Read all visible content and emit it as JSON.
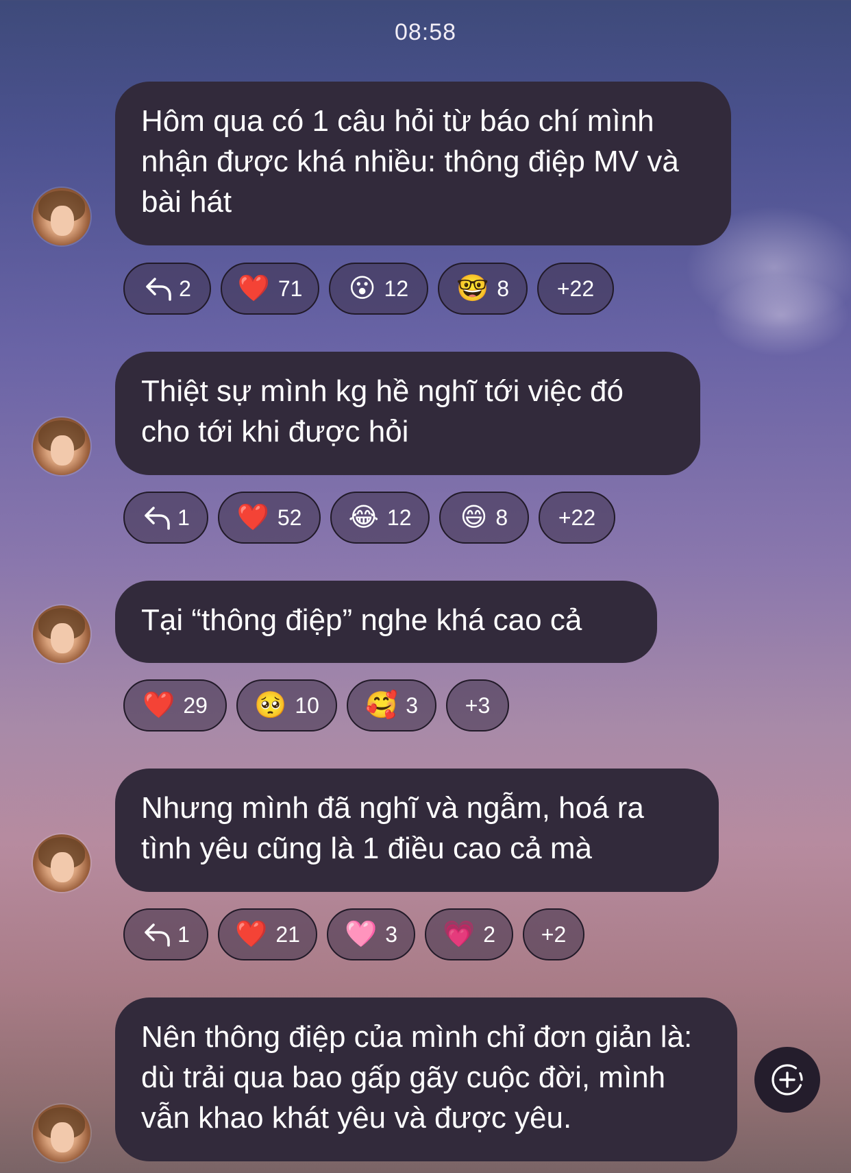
{
  "timestamp": "08:58",
  "messages": [
    {
      "text": "Hôm qua có 1 câu hỏi từ báo chí mình nhận được khá nhiều: thông điệp MV và bài hát",
      "reactions": [
        {
          "type": "reply",
          "icon": "reply-icon",
          "count": "2"
        },
        {
          "type": "emoji",
          "icon": "heart-icon",
          "emoji": "❤️",
          "count": "71"
        },
        {
          "type": "emoji",
          "icon": "surprised-face-icon",
          "emoji": "😮",
          "count": "12"
        },
        {
          "type": "emoji",
          "icon": "nerd-face-icon",
          "emoji": "🤓",
          "count": "8"
        },
        {
          "type": "more",
          "count": "+22"
        }
      ]
    },
    {
      "text": "Thiệt sự mình kg hề nghĩ tới việc đó cho tới khi được hỏi",
      "reactions": [
        {
          "type": "reply",
          "icon": "reply-icon",
          "count": "1"
        },
        {
          "type": "emoji",
          "icon": "heart-icon",
          "emoji": "❤️",
          "count": "52"
        },
        {
          "type": "emoji",
          "icon": "tears-of-joy-icon",
          "emoji": "😂",
          "count": "12"
        },
        {
          "type": "emoji",
          "icon": "grinning-face-icon",
          "emoji": "😄",
          "count": "8"
        },
        {
          "type": "more",
          "count": "+22"
        }
      ]
    },
    {
      "text": "Tại “thông điệp” nghe khá cao cả",
      "reactions": [
        {
          "type": "emoji",
          "icon": "heart-icon",
          "emoji": "❤️",
          "count": "29"
        },
        {
          "type": "emoji",
          "icon": "pleading-face-icon",
          "emoji": "🥺",
          "count": "10"
        },
        {
          "type": "emoji",
          "icon": "smiling-hearts-icon",
          "emoji": "🥰",
          "count": "3"
        },
        {
          "type": "more",
          "count": "+3"
        }
      ]
    },
    {
      "text": "Nhưng mình đã nghĩ và ngẫm, hoá ra tình yêu cũng là 1 điều cao cả mà",
      "reactions": [
        {
          "type": "reply",
          "icon": "reply-icon",
          "count": "1"
        },
        {
          "type": "emoji",
          "icon": "heart-icon",
          "emoji": "❤️",
          "count": "21"
        },
        {
          "type": "emoji",
          "icon": "pink-heart-icon",
          "emoji": "🩷",
          "count": "3"
        },
        {
          "type": "emoji",
          "icon": "growing-heart-icon",
          "emoji": "💗",
          "count": "2"
        },
        {
          "type": "more",
          "count": "+2"
        }
      ]
    },
    {
      "text": "Nên thông điệp của mình chỉ đơn giản là: dù trải qua bao gấp gãy cuộc đời, mình  vẫn khao khát yêu và được yêu.",
      "reactions": []
    }
  ],
  "add_button_icon": "add-reaction-icon"
}
